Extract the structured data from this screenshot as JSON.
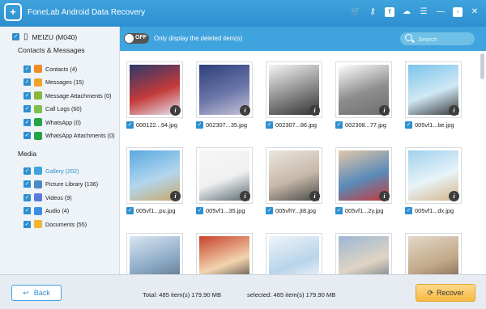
{
  "app": {
    "title": "FoneLab Android Data Recovery"
  },
  "device": {
    "name": "MEIZU (M040)"
  },
  "sidebar": {
    "sections": [
      {
        "title": "Contacts & Messages",
        "items": [
          {
            "label": "Contacts (4)",
            "icon": "contacts-icon",
            "color": "#f08a24"
          },
          {
            "label": "Messages (15)",
            "icon": "messages-icon",
            "color": "#f0a22c"
          },
          {
            "label": "Message Attachments (0)",
            "icon": "attachment-icon",
            "color": "#8ab63f"
          },
          {
            "label": "Call Logs (60)",
            "icon": "phone-icon",
            "color": "#7cc04b"
          },
          {
            "label": "WhatsApp (0)",
            "icon": "whatsapp-icon",
            "color": "#25a345"
          },
          {
            "label": "WhatsApp Attachments (0)",
            "icon": "whatsapp-icon",
            "color": "#25a345"
          }
        ]
      },
      {
        "title": "Media",
        "items": [
          {
            "label": "Gallery (202)",
            "icon": "gallery-icon",
            "color": "#3fa3dd"
          },
          {
            "label": "Picture Library (136)",
            "icon": "picture-icon",
            "color": "#4a88c8"
          },
          {
            "label": "Videos (9)",
            "icon": "video-icon",
            "color": "#5a7ad8"
          },
          {
            "label": "Audio (4)",
            "icon": "audio-icon",
            "color": "#3a8ee0"
          },
          {
            "label": "Documents (55)",
            "icon": "folder-icon",
            "color": "#f2b632"
          }
        ]
      }
    ]
  },
  "toolbar": {
    "toggle_label": "OFF",
    "filter_label": "Only display the deleted item(s)",
    "search_placeholder": "Search"
  },
  "files": [
    {
      "name": "000122...94.jpg",
      "colors": [
        "#2a3a6a",
        "#c43a3a",
        "#e4e4ee"
      ]
    },
    {
      "name": "002307...35.jpg",
      "colors": [
        "#2d3e7a",
        "#6a76a8",
        "#c9c2d8"
      ]
    },
    {
      "name": "002307...86.jpg",
      "colors": [
        "#f5f5f5",
        "#8a8a8a",
        "#333333"
      ]
    },
    {
      "name": "002308...77.jpg",
      "colors": [
        "#ffffff",
        "#8d8d8d",
        "#6e6e6e"
      ]
    },
    {
      "name": "005vf1...be.jpg",
      "colors": [
        "#7cc3ea",
        "#cfe8f5",
        "#3a3a3a"
      ]
    },
    {
      "name": "005vf1...pu.jpg",
      "colors": [
        "#5aa8e0",
        "#b3d6ee",
        "#c9a86a"
      ]
    },
    {
      "name": "005vf1...35.jpg",
      "colors": [
        "#f6f6f6",
        "#f0f0f0",
        "#5a6a72"
      ]
    },
    {
      "name": "005vfIY...jt8.jpg",
      "colors": [
        "#eae5df",
        "#c7b9a8",
        "#4a4a4a"
      ]
    },
    {
      "name": "005vf1...2y.jpg",
      "colors": [
        "#e3c7a8",
        "#5a8ab8",
        "#c63a3a"
      ]
    },
    {
      "name": "005vf1...dx.jpg",
      "colors": [
        "#9fd0ee",
        "#e8f3f8",
        "#d4b48a"
      ]
    },
    {
      "name": "",
      "colors": [
        "#d8e6f2",
        "#8aa8c4",
        "#56677a"
      ]
    },
    {
      "name": "",
      "colors": [
        "#c7422a",
        "#f3d4b0",
        "#2a2a2a"
      ]
    },
    {
      "name": "",
      "colors": [
        "#eef4fa",
        "#b8d4ea",
        "#ffffff"
      ]
    },
    {
      "name": "",
      "colors": [
        "#9cb8d4",
        "#e0d4c4",
        "#5a6a7a"
      ]
    },
    {
      "name": "",
      "colors": [
        "#e4d8c8",
        "#c2a888",
        "#6a5a4a"
      ]
    }
  ],
  "footer": {
    "back_label": "Back",
    "total_label": "Total: 485 item(s) 179.90 MB",
    "selected_label": "selected: 485 item(s) 179.90 MB",
    "recover_label": "Recover"
  },
  "colors": {
    "accent": "#3fa3dd",
    "recover": "#f5b942"
  }
}
